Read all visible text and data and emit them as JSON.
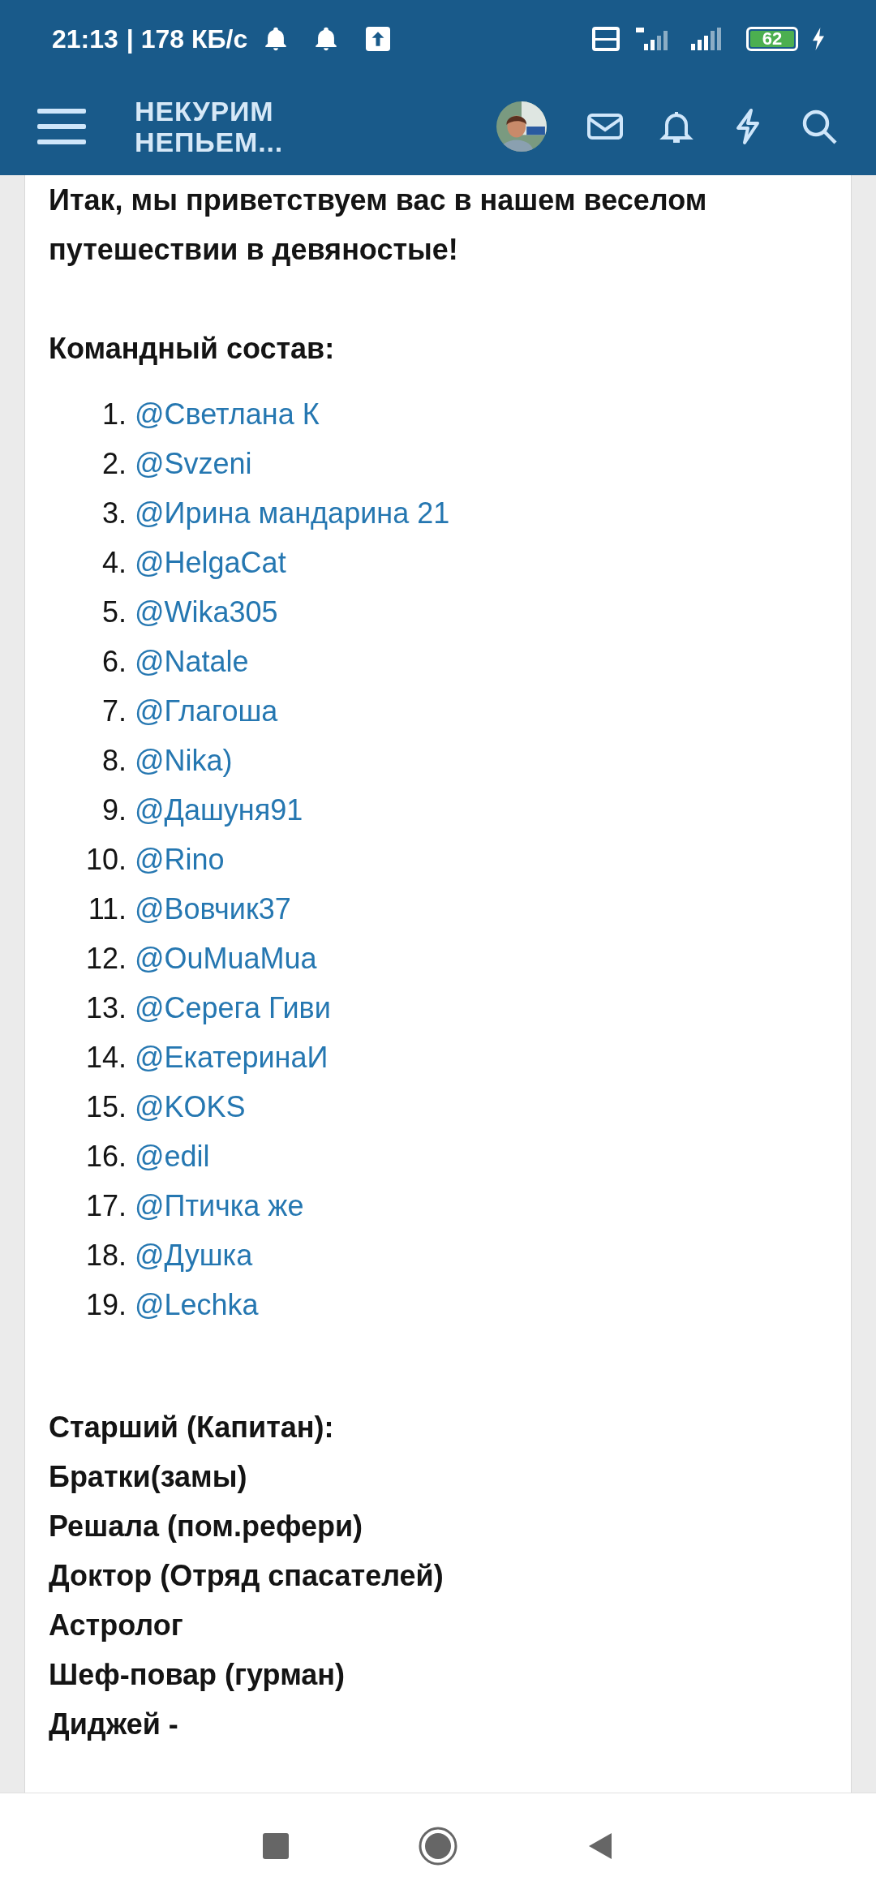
{
  "status_bar": {
    "time": "21:13",
    "speed": "| 178 КБ/с",
    "battery": "62"
  },
  "header": {
    "logo_line_1": "НЕКУРИМ",
    "logo_line_2": "НЕПЬЕМ..."
  },
  "post": {
    "intro": "Итак, мы приветствуем вас в нашем веселом путешествии в девяностые!",
    "team_heading": "Командный состав:",
    "members": [
      {
        "number": "1.",
        "name": "@Светлана К"
      },
      {
        "number": "2.",
        "name": "@Svzeni"
      },
      {
        "number": "3.",
        "name": "@Ирина мандарина 21"
      },
      {
        "number": "4.",
        "name": "@HelgaCat"
      },
      {
        "number": "5.",
        "name": "@Wika305"
      },
      {
        "number": "6.",
        "name": "@Natale"
      },
      {
        "number": "7.",
        "name": "@Глагоша"
      },
      {
        "number": "8.",
        "name": "@Nika)"
      },
      {
        "number": "9.",
        "name": "@Дашуня91"
      },
      {
        "number": "10.",
        "name": "@Rino"
      },
      {
        "number": "11.",
        "name": "@Вовчик37"
      },
      {
        "number": "12.",
        "name": "@OuMuaMua"
      },
      {
        "number": "13.",
        "name": "@Серега Гиви"
      },
      {
        "number": "14.",
        "name": "@ЕкатеринаИ"
      },
      {
        "number": "15.",
        "name": "@KOKS"
      },
      {
        "number": "16.",
        "name": "@edil"
      },
      {
        "number": "17.",
        "name": "@Птичка же"
      },
      {
        "number": "18.",
        "name": "@Душка"
      },
      {
        "number": "19.",
        "name": "@Lechka"
      }
    ],
    "roles": [
      "Старший (Капитан):",
      "Братки(замы)",
      "Решала (пом.рефери)",
      "Доктор (Отряд спасателей)",
      "Астролог",
      "Шеф-повар (гурман)",
      "Диджей -"
    ]
  }
}
